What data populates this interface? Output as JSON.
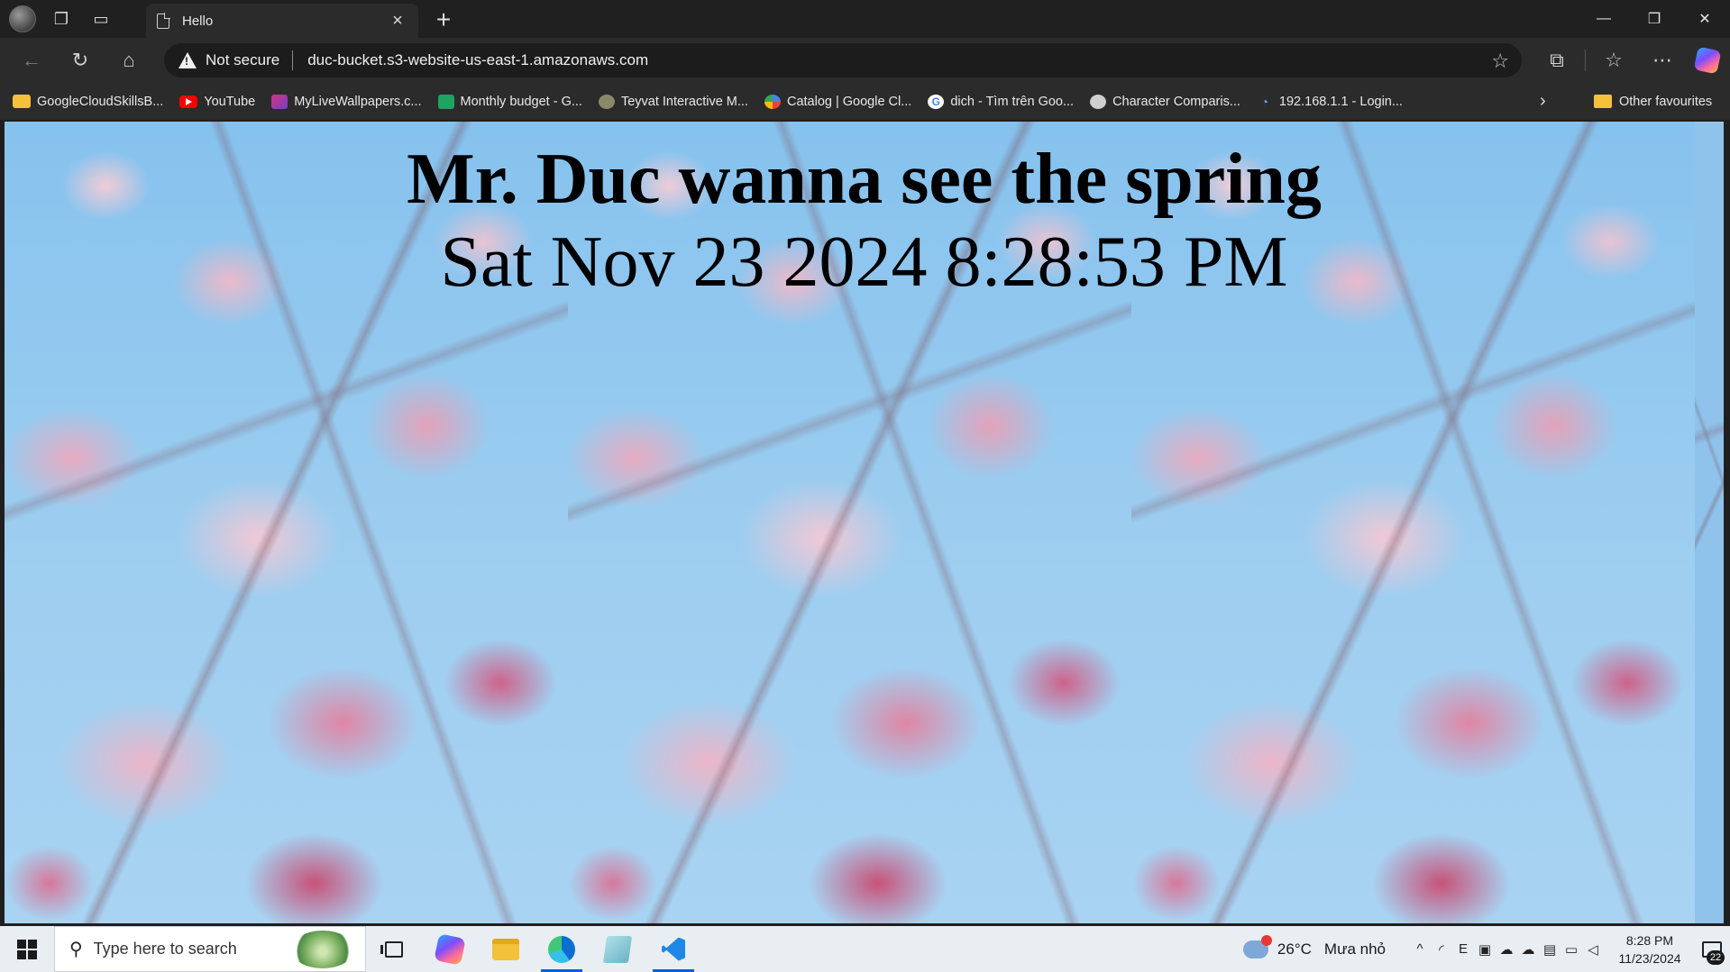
{
  "browser": {
    "tab": {
      "title": "Hello",
      "icon": "document-icon"
    },
    "address": {
      "security_label": "Not secure",
      "url": "duc-bucket.s3-website-us-east-1.amazonaws.com"
    },
    "favorites": [
      {
        "label": "GoogleCloudSkillsB...",
        "icon": "folder-icon"
      },
      {
        "label": "YouTube",
        "icon": "youtube-icon"
      },
      {
        "label": "MyLiveWallpapers.c...",
        "icon": "mylivewallpapers-icon"
      },
      {
        "label": "Monthly budget - G...",
        "icon": "google-sheets-icon"
      },
      {
        "label": "Teyvat Interactive M...",
        "icon": "teyvat-map-icon"
      },
      {
        "label": "Catalog | Google Cl...",
        "icon": "google-cloud-icon"
      },
      {
        "label": "dich - Tìm trên Goo...",
        "icon": "google-icon"
      },
      {
        "label": "Character Comparis...",
        "icon": "character-icon"
      },
      {
        "label": "192.168.1.1 - Login...",
        "icon": "router-icon"
      }
    ],
    "other_favourites": "Other favourites"
  },
  "page": {
    "headline": "Mr. Duc wanna see the spring",
    "datetime": "Sat Nov 23 2024 8:28:53 PM",
    "background": "cherry-blossom-image"
  },
  "taskbar": {
    "search_placeholder": "Type here to search",
    "weather": {
      "temp": "26°C",
      "condition": "Mưa nhỏ"
    },
    "clock": {
      "time": "8:28 PM",
      "date": "11/23/2024"
    },
    "notification_count": "22"
  },
  "colors": {
    "titlebar": "#202020",
    "toolbar": "#2b2b2b",
    "sky": "#8fc3ec",
    "taskbar": "#e9eef3",
    "accent": "#0a5fd6"
  }
}
